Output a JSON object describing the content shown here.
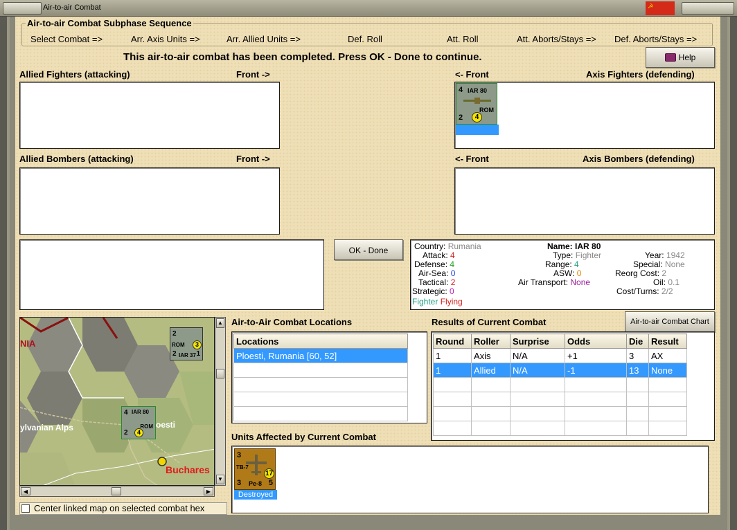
{
  "window": {
    "title": "Air-to-air Combat"
  },
  "subphase": {
    "title": "Air-to-air Combat Subphase Sequence",
    "steps": [
      "Select Combat =>",
      "Arr. Axis Units =>",
      "Arr. Allied Units =>",
      "Def. Roll",
      "Att. Roll",
      "Att. Aborts/Stays =>",
      "Def. Aborts/Stays =>"
    ]
  },
  "message": "This air-to-air combat has been completed.  Press OK - Done to continue.",
  "help_label": "Help",
  "sections": {
    "allied_fighters": "Allied Fighters (attacking)",
    "allied_bombers": "Allied Bombers (attacking)",
    "axis_fighters": "Axis Fighters (defending)",
    "axis_bombers": "Axis Bombers (defending)",
    "front_right": "Front ->",
    "front_left": "<- Front"
  },
  "axis_unit": {
    "attack": "4",
    "name": "IAR 80",
    "country": "ROM",
    "defense": "2",
    "number": "4"
  },
  "ok_label": "OK - Done",
  "info": {
    "country_k": "Country:",
    "country_v": "Rumania",
    "attack_k": "Attack:",
    "attack_v": "4",
    "defense_k": "Defense:",
    "defense_v": "4",
    "airsea_k": "Air-Sea:",
    "airsea_v": "0",
    "tactical_k": "Tactical:",
    "tactical_v": "2",
    "strategic_k": "Strategic:",
    "strategic_v": "0",
    "fighter": "Fighter",
    "flying": "Flying",
    "name_k": "Name:",
    "name_v": "IAR 80",
    "type_k": "Type:",
    "type_v": "Fighter",
    "range_k": "Range:",
    "range_v": "4",
    "asw_k": "ASW:",
    "asw_v": "0",
    "airtransport_k": "Air Transport:",
    "airtransport_v": "None",
    "year_k": "Year:",
    "year_v": "1942",
    "special_k": "Special:",
    "special_v": "None",
    "reorg_k": "Reorg Cost:",
    "reorg_v": "2",
    "oil_k": "Oil:",
    "oil_v": "0.1",
    "costturns_k": "Cost/Turns:",
    "costturns_v": "2/2"
  },
  "map": {
    "labels": {
      "nia": "NIA",
      "alps": "ylvanian Alps",
      "ploesti": "oesti",
      "bucharest": "Buchares"
    },
    "unit_a": {
      "attack": "2",
      "name": "IAR 37",
      "country": "ROM",
      "defense": "2",
      "range": "1",
      "number": "3"
    },
    "unit_b": {
      "attack": "4",
      "name": "IAR 80",
      "country": "ROM",
      "defense": "2",
      "number": "4"
    }
  },
  "center_label": "Center linked map on selected combat hex",
  "locations": {
    "title": "Air-to-Air Combat Locations",
    "header": "Locations",
    "rows": [
      "Ploesti, Rumania [60, 52]"
    ]
  },
  "results": {
    "title": "Results of Current Combat",
    "chart_button": "Air-to-air Combat Chart",
    "headers": [
      "Round",
      "Roller",
      "Surprise",
      "Odds",
      "Die",
      "Result"
    ],
    "rows": [
      [
        "1",
        "Axis",
        "N/A",
        "+1",
        "3",
        "AX"
      ],
      [
        "1",
        "Allied",
        "N/A",
        "-1",
        "13",
        "None"
      ]
    ]
  },
  "affected": {
    "title": "Units Affected by Current Combat",
    "unit": {
      "attack": "3",
      "top_name": "TB-7",
      "name": "Pe-8",
      "defense": "3",
      "range": "5",
      "number": "17"
    },
    "status": "Destroyed"
  },
  "colors": {
    "panel": "#efdfb6",
    "selection": "#3399ff",
    "attack": "#d42020",
    "defense": "#20a020",
    "airsea": "#2040d0",
    "asw": "#e08000",
    "strategic": "#c020c0",
    "fighter": "#20a080",
    "gray_value": "#888888"
  }
}
